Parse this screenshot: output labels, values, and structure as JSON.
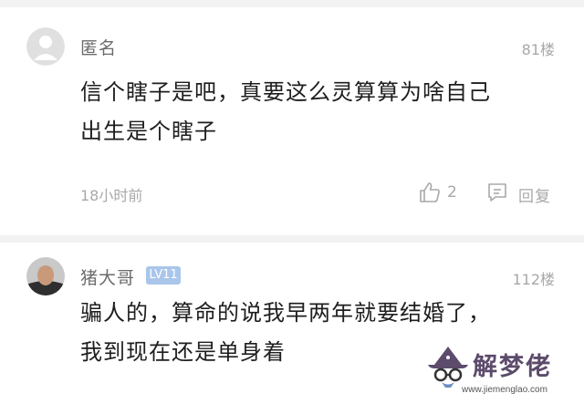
{
  "comments": [
    {
      "username": "匿名",
      "floor": "81楼",
      "text_lines": [
        "信个瞎子是吧，真要这么灵算算为啥自己",
        "出生是个瞎子"
      ],
      "time": "18小时前",
      "like_count": "2",
      "reply_label": "回复",
      "avatar_icon": "anonymous-avatar-icon"
    },
    {
      "username": "猪大哥",
      "level_badge": "LV11",
      "floor": "112楼",
      "text_lines": [
        "骗人的，算命的说我早两年就要结婚了，",
        "我到现在还是单身着"
      ],
      "avatar_icon": "user-photo-avatar"
    }
  ],
  "watermark": {
    "logo_text": "解梦佬",
    "url": "www.jiemenglao.com",
    "icon": "wizard-hat-glasses-icon"
  },
  "colors": {
    "background": "#f2f2f2",
    "card": "#ffffff",
    "badge": "#a9c6ea",
    "meta_text": "#a8a8a8",
    "body_text": "#1e1e1e",
    "watermark": "#5c4b6b"
  }
}
